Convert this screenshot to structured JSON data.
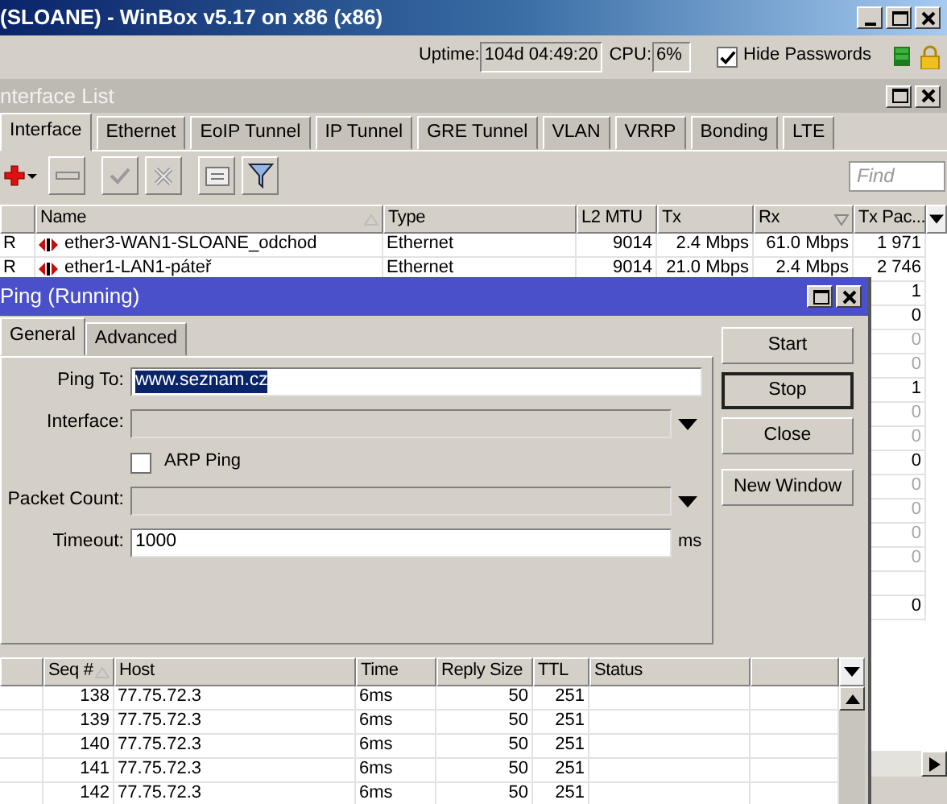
{
  "app_window": {
    "title": "(SLOANE) - WinBox v5.17 on x86 (x86)"
  },
  "status": {
    "uptime_label": "Uptime:",
    "uptime": "104d 04:49:20",
    "cpu_label": "CPU:",
    "cpu": "6%",
    "hide_passwords": {
      "label": "Hide Passwords",
      "checked": true
    }
  },
  "interface_list": {
    "title": "nterface List",
    "tabs": [
      {
        "label": "Interface",
        "selected": true
      },
      {
        "label": "Ethernet",
        "selected": false
      },
      {
        "label": "EoIP Tunnel",
        "selected": false
      },
      {
        "label": "IP Tunnel",
        "selected": false
      },
      {
        "label": "GRE Tunnel",
        "selected": false
      },
      {
        "label": "VLAN",
        "selected": false
      },
      {
        "label": "VRRP",
        "selected": false
      },
      {
        "label": "Bonding",
        "selected": false
      },
      {
        "label": "LTE",
        "selected": false
      }
    ],
    "find": {
      "placeholder": "Find"
    },
    "columns": [
      {
        "label": "Name",
        "sorted": true,
        "descending": false
      },
      {
        "label": "Type"
      },
      {
        "label": "L2 MTU"
      },
      {
        "label": "Tx"
      },
      {
        "label": "Rx",
        "sorted": true,
        "descending": true
      },
      {
        "label": "Tx Pac..."
      }
    ],
    "rows": [
      {
        "flag": "R",
        "name": "ether3-WAN1-SLOANE_odchod",
        "type": "Ethernet",
        "l2mtu": "9014",
        "tx": "2.4 Mbps",
        "rx": "61.0 Mbps",
        "tx_packets": "1 971",
        "disabled": false
      },
      {
        "flag": "R",
        "name": "ether1-LAN1-páteř",
        "type": "Ethernet",
        "l2mtu": "9014",
        "tx": "21.0 Mbps",
        "rx": "2.4 Mbps",
        "tx_packets": "2 746",
        "disabled": false
      },
      {
        "tx_packets": "1",
        "disabled": false
      },
      {
        "tx_packets": "0",
        "disabled": false
      },
      {
        "tx_packets": "0",
        "disabled": true
      },
      {
        "tx_packets": "0",
        "disabled": true
      },
      {
        "tx_packets": "1",
        "disabled": false
      },
      {
        "tx_packets": "0",
        "disabled": true
      },
      {
        "tx_packets": "0",
        "disabled": true
      },
      {
        "tx_packets": "0",
        "disabled": false
      },
      {
        "tx_packets": "0",
        "disabled": true
      },
      {
        "tx_packets": "0",
        "disabled": true
      },
      {
        "tx_packets": "0",
        "disabled": true
      },
      {
        "tx_packets": "0",
        "disabled": true
      },
      {},
      {
        "tx_packets": "0",
        "disabled": false
      }
    ]
  },
  "ping": {
    "title": "Ping (Running)",
    "tabs": [
      {
        "label": "General",
        "selected": true
      },
      {
        "label": "Advanced",
        "selected": false
      }
    ],
    "fields": [
      {
        "kind": "text",
        "label": "Ping To:",
        "value": "www.seznam.cz",
        "text_selected": true,
        "disabled": false
      },
      {
        "kind": "dropdown",
        "label": "Interface:",
        "disabled": true
      },
      {
        "kind": "checkbox",
        "label": "ARP Ping",
        "checked": false
      },
      {
        "kind": "dropdown",
        "label": "Packet Count:",
        "disabled": true
      },
      {
        "kind": "text",
        "label": "Timeout:",
        "value": "1000",
        "unit": "ms",
        "text_selected": false,
        "disabled": false
      }
    ],
    "buttons": [
      {
        "label": "Start",
        "focused": false
      },
      {
        "label": "Stop",
        "focused": true
      },
      {
        "label": "Close",
        "focused": false
      },
      {
        "label": "New Window",
        "focused": false
      }
    ],
    "columns": [
      {
        "label": "Seq #",
        "sorted": true,
        "descending": false
      },
      {
        "label": "Host"
      },
      {
        "label": "Time"
      },
      {
        "label": "Reply Size"
      },
      {
        "label": "TTL"
      },
      {
        "label": "Status"
      }
    ],
    "rows": [
      {
        "seq": "138",
        "host": "77.75.72.3",
        "time": "6ms",
        "reply_size": "50",
        "ttl": "251"
      },
      {
        "seq": "139",
        "host": "77.75.72.3",
        "time": "6ms",
        "reply_size": "50",
        "ttl": "251"
      },
      {
        "seq": "140",
        "host": "77.75.72.3",
        "time": "6ms",
        "reply_size": "50",
        "ttl": "251"
      },
      {
        "seq": "141",
        "host": "77.75.72.3",
        "time": "6ms",
        "reply_size": "50",
        "ttl": "251"
      },
      {
        "seq": "142",
        "host": "77.75.72.3",
        "time": "6ms",
        "reply_size": "50",
        "ttl": "251"
      }
    ]
  }
}
